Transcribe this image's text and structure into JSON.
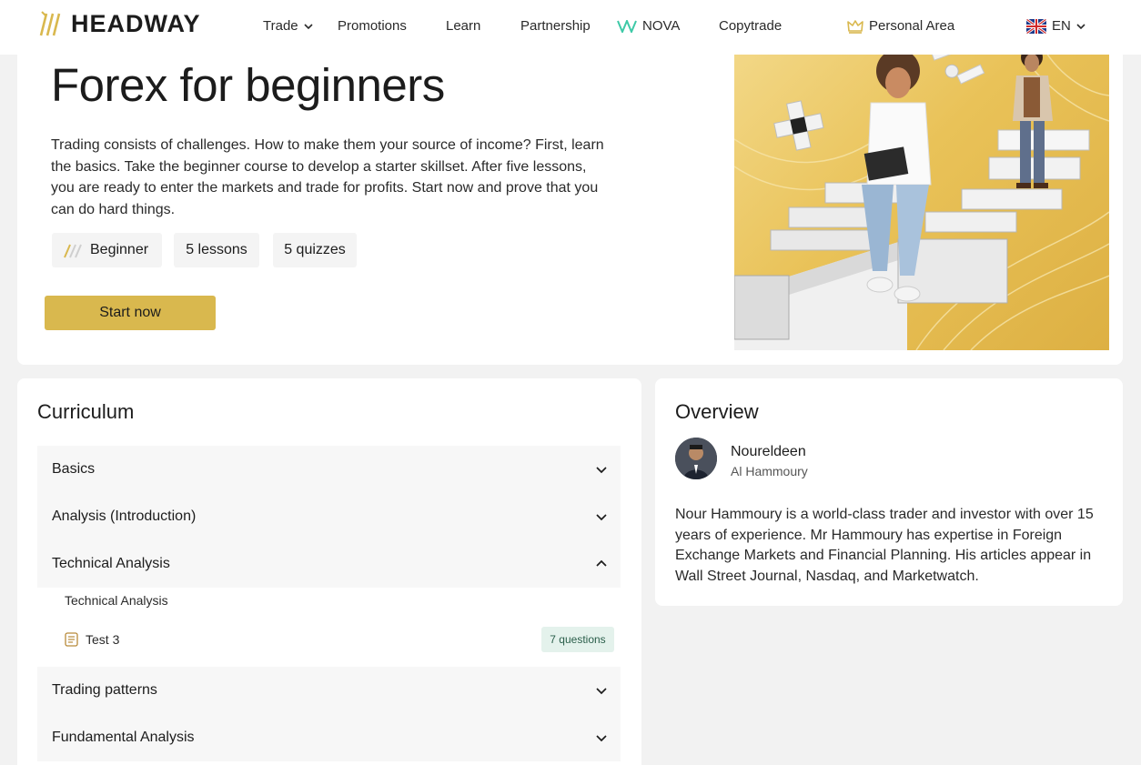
{
  "header": {
    "logo_text": "HEADWAY",
    "nav": {
      "trade": "Trade",
      "promotions": "Promotions",
      "learn": "Learn",
      "partnership": "Partnership",
      "nova": "NOVA",
      "copytrade": "Copytrade",
      "personal_area": "Personal Area",
      "language": "EN"
    }
  },
  "hero": {
    "title": "Forex for beginners",
    "description": "Trading consists of challenges. How to make them your source of income? First, learn the basics. Take the beginner course to develop a starter skillset. After five lessons, you are ready to enter the markets and trade for profits. Start now and prove that you can do hard things.",
    "tags": {
      "level": "Beginner",
      "lessons": "5 lessons",
      "quizzes": "5 quizzes"
    },
    "cta_label": "Start now"
  },
  "curriculum": {
    "title": "Curriculum",
    "sections": [
      {
        "label": "Basics",
        "expanded": false
      },
      {
        "label": "Analysis (Introduction)",
        "expanded": false
      },
      {
        "label": "Technical Analysis",
        "expanded": true
      },
      {
        "label": "Trading patterns",
        "expanded": false
      },
      {
        "label": "Fundamental Analysis",
        "expanded": false
      }
    ],
    "technical_items": {
      "lesson": "Technical Analysis",
      "test": "Test 3",
      "test_badge": "7 questions"
    }
  },
  "overview": {
    "title": "Overview",
    "author_first": "Noureldeen",
    "author_last": "Al Hammoury",
    "description": "Nour Hammoury is a world-class trader and investor with over 15 years of experience. Mr Hammoury has expertise in Foreign Exchange Markets and Financial Planning. His articles appear in Wall Street Journal, Nasdaq, and Marketwatch."
  },
  "colors": {
    "brand_gold": "#d9b84e",
    "badge_bg": "#e4f2ec",
    "nova_teal": "#3ec9a7"
  },
  "icons": [
    "headway-logo-icon",
    "chevron-down-icon",
    "nova-icon",
    "crown-icon",
    "uk-flag-icon",
    "beginner-level-icon",
    "chevron-up-icon",
    "document-icon"
  ]
}
